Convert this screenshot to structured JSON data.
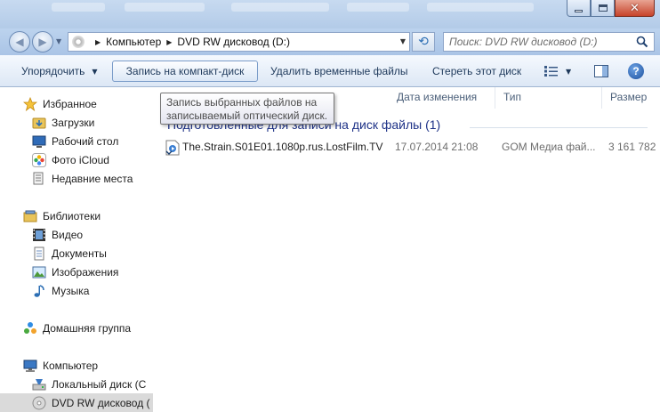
{
  "address": {
    "crumbs": [
      "Компьютер",
      "DVD RW дисковод (D:)"
    ],
    "search_placeholder": "Поиск: DVD RW дисковод (D:)"
  },
  "toolbar": {
    "organize": "Упорядочить",
    "burn": "Запись на компакт-диск",
    "delete_temp": "Удалить временные файлы",
    "erase": "Стереть этот диск",
    "help": "?"
  },
  "tooltip": {
    "line1": "Запись выбранных файлов на",
    "line2": "записываемый оптический диск."
  },
  "sidebar": {
    "favorites": "Избранное",
    "downloads": "Загрузки",
    "desktop": "Рабочий стол",
    "icloud": "Фото iCloud",
    "recent": "Недавние места",
    "libraries": "Библиотеки",
    "video": "Видео",
    "documents": "Документы",
    "images": "Изображения",
    "music": "Музыка",
    "homegroup": "Домашняя группа",
    "computer": "Компьютер",
    "local_disk": "Локальный диск (С",
    "dvd_drive": "DVD RW дисковод ("
  },
  "columns": {
    "date": "Дата изменения",
    "type": "Тип",
    "size": "Размер"
  },
  "group": {
    "title": "Подготовленные для записи на диск файлы (1)"
  },
  "files": [
    {
      "name": "The.Strain.S01E01.1080p.rus.LostFilm.TV",
      "date": "17.07.2014 21:08",
      "type": "GOM Медиа фай...",
      "size": "3 161 782"
    }
  ]
}
